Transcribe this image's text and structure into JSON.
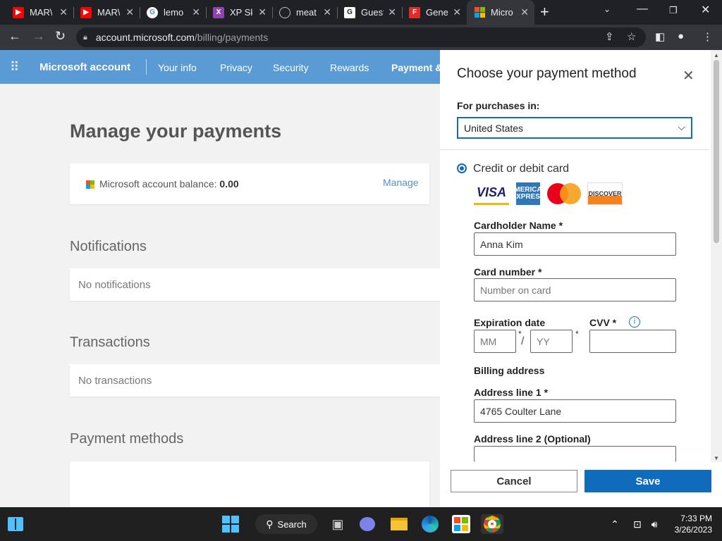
{
  "browser": {
    "tabs": [
      {
        "title": "MAR\\",
        "icon": "youtube-icon",
        "color": "#ff0000"
      },
      {
        "title": "MAR\\",
        "icon": "youtube-icon",
        "color": "#ff0000"
      },
      {
        "title": "lemo",
        "icon": "google-icon",
        "color": "#4285f4"
      },
      {
        "title": "XP Sk",
        "icon": "xp-icon",
        "color": "#8e44ad"
      },
      {
        "title": "meat",
        "icon": "globe-icon",
        "color": "#9aa0a6"
      },
      {
        "title": "Guest",
        "icon": "g-icon",
        "color": "#ffffff"
      },
      {
        "title": "Gene",
        "icon": "f-icon",
        "color": "#e22a2a"
      },
      {
        "title": "Micro",
        "icon": "microsoft-icon",
        "color": "#f25022",
        "active": true
      }
    ],
    "url_host": "account.microsoft.com",
    "url_path": "/billing/payments"
  },
  "ms_nav": {
    "brand": "Microsoft account",
    "links": [
      "Your info",
      "Privacy",
      "Security",
      "Rewards",
      "Payment &"
    ]
  },
  "page": {
    "title": "Manage your payments",
    "balance_label": "Microsoft account balance:",
    "balance_value": "0.00",
    "manage_label": "Manage",
    "notifications_heading": "Notifications",
    "notifications_empty": "No notifications",
    "transactions_heading": "Transactions",
    "transactions_empty": "No transactions",
    "payment_methods_heading": "Payment methods"
  },
  "panel": {
    "title": "Choose your payment method",
    "purchases_label": "For purchases in:",
    "country": "United States",
    "method_label": "Credit or debit card",
    "card_brands": {
      "visa": "VISA",
      "amex": "AMERICAN EXPRESS",
      "discover": "DISCOVER"
    },
    "cardholder_label": "Cardholder Name *",
    "cardholder_value": "Anna Kim",
    "card_number_label": "Card number *",
    "card_number_placeholder": "Number on card",
    "expiration_label": "Expiration date",
    "month_placeholder": "MM",
    "year_placeholder": "YY",
    "separator": "/",
    "required_mark": "*",
    "cvv_label": "CVV *",
    "billing_heading": "Billing address",
    "address1_label": "Address line 1 *",
    "address1_value": "4765 Coulter Lane",
    "address2_label": "Address line 2 (Optional)",
    "cancel_label": "Cancel",
    "save_label": "Save"
  },
  "taskbar": {
    "search_label": "Search",
    "time": "7:33 PM",
    "date": "3/26/2023"
  },
  "colors": {
    "accent": "#0f6cbd",
    "nav_bg": "#5b9bd5"
  }
}
